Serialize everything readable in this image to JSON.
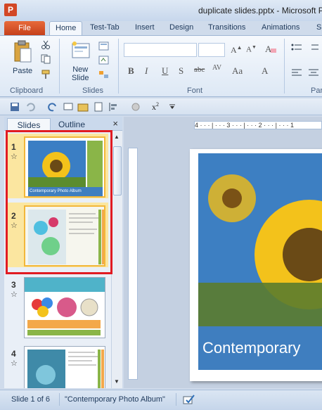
{
  "window": {
    "title": "duplicate slides.pptx - Microsoft P",
    "app_icon": "P"
  },
  "tabs": [
    "File",
    "Home",
    "Test-Tab",
    "Insert",
    "Design",
    "Transitions",
    "Animations",
    "S"
  ],
  "ribbon": {
    "groups": {
      "clipboard": "Clipboard",
      "slides": "Slides",
      "font": "Font",
      "paragraph": "Par"
    },
    "paste_label": "Paste",
    "new_slide_label": "New Slide",
    "new_slide_line1": "New",
    "new_slide_line2": "Slide"
  },
  "slides_pane": {
    "tabs": [
      "Slides",
      "Outline"
    ],
    "close": "×",
    "slides": [
      {
        "number": "1",
        "title": "Contemporary Photo Album",
        "selected": true
      },
      {
        "number": "2",
        "title": "",
        "selected": true
      },
      {
        "number": "3",
        "title": "",
        "selected": false
      },
      {
        "number": "4",
        "title": "",
        "selected": false
      }
    ]
  },
  "ruler": {
    "h_labels": "4 · · · | · · · 3 · · · | · · · 2 · · · | · · · 1"
  },
  "main_slide": {
    "title": "Contemporary"
  },
  "status": {
    "slide_info": "Slide 1 of 6",
    "theme": "\"Contemporary Photo Album\""
  },
  "colors": {
    "file_tab": "#c5401b",
    "accent_blue": "#3f7ebf",
    "selection": "#f2b73a",
    "highlight_box": "#e11b22"
  }
}
